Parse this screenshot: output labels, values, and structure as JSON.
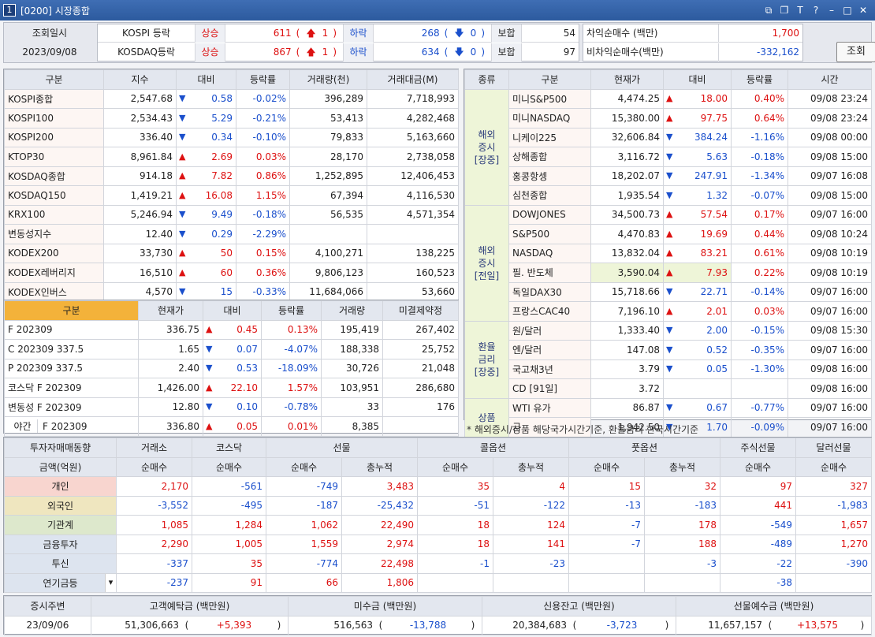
{
  "window": {
    "num": "1",
    "title": "[0200] 시장종합"
  },
  "topbar": {
    "date_label": "조회일시",
    "date_value": "2023/09/08",
    "rows": [
      {
        "market": "KOSPI 등락",
        "up_label": "상승",
        "up": "611",
        "up_limit": "1",
        "down_label": "하락",
        "down": "268",
        "down_limit": "0",
        "flat_label": "보합",
        "flat": "54"
      },
      {
        "market": "KOSDAQ등락",
        "up_label": "상승",
        "up": "867",
        "up_limit": "1",
        "down_label": "하락",
        "down": "634",
        "down_limit": "0",
        "flat_label": "보합",
        "flat": "97"
      }
    ],
    "program": [
      {
        "label": "차익순매수 (백만)",
        "value": "1,700"
      },
      {
        "label": "비차익순매수(백만)",
        "value": "-332,162"
      }
    ],
    "query_button": "조회"
  },
  "index_table": {
    "headers": [
      "구분",
      "지수",
      "대비",
      "등락률",
      "거래량(천)",
      "거래대금(M)"
    ],
    "rows": [
      {
        "name": "KOSPI종합",
        "value": "2,547.68",
        "dir": "dn",
        "chg": "0.58",
        "rate": "-0.02%",
        "vol": "396,289",
        "amt": "7,718,993"
      },
      {
        "name": "KOSPI100",
        "value": "2,534.43",
        "dir": "dn",
        "chg": "5.29",
        "rate": "-0.21%",
        "vol": "53,413",
        "amt": "4,282,468"
      },
      {
        "name": "KOSPI200",
        "value": "336.40",
        "dir": "dn",
        "chg": "0.34",
        "rate": "-0.10%",
        "vol": "79,833",
        "amt": "5,163,660"
      },
      {
        "name": "KTOP30",
        "value": "8,961.84",
        "dir": "up",
        "chg": "2.69",
        "rate": "0.03%",
        "vol": "28,170",
        "amt": "2,738,058"
      },
      {
        "name": "KOSDAQ종합",
        "value": "914.18",
        "dir": "up",
        "chg": "7.82",
        "rate": "0.86%",
        "vol": "1,252,895",
        "amt": "12,406,453"
      },
      {
        "name": "KOSDAQ150",
        "value": "1,419.21",
        "dir": "up",
        "chg": "16.08",
        "rate": "1.15%",
        "vol": "67,394",
        "amt": "4,116,530"
      },
      {
        "name": "KRX100",
        "value": "5,246.94",
        "dir": "dn",
        "chg": "9.49",
        "rate": "-0.18%",
        "vol": "56,535",
        "amt": "4,571,354"
      },
      {
        "name": "변동성지수",
        "value": "12.40",
        "dir": "dn",
        "chg": "0.29",
        "rate": "-2.29%",
        "vol": "",
        "amt": ""
      },
      {
        "name": "KODEX200",
        "value": "33,730",
        "dir": "up",
        "chg": "50",
        "rate": "0.15%",
        "vol": "4,100,271",
        "amt": "138,225"
      },
      {
        "name": "KODEX레버리지",
        "value": "16,510",
        "dir": "up",
        "chg": "60",
        "rate": "0.36%",
        "vol": "9,806,123",
        "amt": "160,523"
      },
      {
        "name": "KODEX인버스",
        "value": "4,570",
        "dir": "dn",
        "chg": "15",
        "rate": "-0.33%",
        "vol": "11,684,066",
        "amt": "53,660"
      }
    ]
  },
  "futures_table": {
    "headers": [
      "구분",
      "현재가",
      "대비",
      "등락률",
      "거래량",
      "미결제약정"
    ],
    "rows": [
      {
        "name": "F 202309",
        "value": "336.75",
        "dir": "up",
        "chg": "0.45",
        "rate": "0.13%",
        "vol": "195,419",
        "oi": "267,402"
      },
      {
        "name": "C 202309 337.5",
        "value": "1.65",
        "dir": "dn",
        "chg": "0.07",
        "rate": "-4.07%",
        "vol": "188,338",
        "oi": "25,752"
      },
      {
        "name": "P 202309 337.5",
        "value": "2.40",
        "dir": "dn",
        "chg": "0.53",
        "rate": "-18.09%",
        "vol": "30,726",
        "oi": "21,048"
      },
      {
        "name": "코스닥 F 202309",
        "value": "1,426.00",
        "dir": "up",
        "chg": "22.10",
        "rate": "1.57%",
        "vol": "103,951",
        "oi": "286,680"
      },
      {
        "name": "변동성 F 202309",
        "value": "12.80",
        "dir": "dn",
        "chg": "0.10",
        "rate": "-0.78%",
        "vol": "33",
        "oi": "176"
      }
    ],
    "night": {
      "tag": "야간",
      "name": "F 202309",
      "value": "336.80",
      "dir": "up",
      "chg": "0.05",
      "rate": "0.01%",
      "vol": "8,385",
      "oi": ""
    }
  },
  "overseas_table": {
    "headers": [
      "종류",
      "구분",
      "현재가",
      "대비",
      "등락률",
      "시간"
    ],
    "groups": [
      {
        "label": "해외\n증시\n[장중]",
        "rows": [
          {
            "name": "미니S&P500",
            "value": "4,474.25",
            "dir": "up",
            "chg": "18.00",
            "rate": "0.40%",
            "time": "09/08 23:24"
          },
          {
            "name": "미니NASDAQ",
            "value": "15,380.00",
            "dir": "up",
            "chg": "97.75",
            "rate": "0.64%",
            "time": "09/08 23:24"
          },
          {
            "name": "니케이225",
            "value": "32,606.84",
            "dir": "dn",
            "chg": "384.24",
            "rate": "-1.16%",
            "time": "09/08 00:00"
          },
          {
            "name": "상해종합",
            "value": "3,116.72",
            "dir": "dn",
            "chg": "5.63",
            "rate": "-0.18%",
            "time": "09/08 15:00"
          },
          {
            "name": "홍콩항셍",
            "value": "18,202.07",
            "dir": "dn",
            "chg": "247.91",
            "rate": "-1.34%",
            "time": "09/07 16:08"
          },
          {
            "name": "심천종합",
            "value": "1,935.54",
            "dir": "dn",
            "chg": "1.32",
            "rate": "-0.07%",
            "time": "09/08 15:00"
          }
        ]
      },
      {
        "label": "해외\n증시\n[전일]",
        "rows": [
          {
            "name": "DOWJONES",
            "value": "34,500.73",
            "dir": "up",
            "chg": "57.54",
            "rate": "0.17%",
            "time": "09/07 16:00"
          },
          {
            "name": "S&P500",
            "value": "4,470.83",
            "dir": "up",
            "chg": "19.69",
            "rate": "0.44%",
            "time": "09/08 10:24"
          },
          {
            "name": "NASDAQ",
            "value": "13,832.04",
            "dir": "up",
            "chg": "83.21",
            "rate": "0.61%",
            "time": "09/08 10:19"
          },
          {
            "name": "필. 반도체",
            "value": "3,590.04",
            "dir": "up",
            "chg": "7.93",
            "rate": "0.22%",
            "time": "09/08 10:19"
          },
          {
            "name": "독일DAX30",
            "value": "15,718.66",
            "dir": "dn",
            "chg": "22.71",
            "rate": "-0.14%",
            "time": "09/07 16:00"
          },
          {
            "name": "프랑스CAC40",
            "value": "7,196.10",
            "dir": "up",
            "chg": "2.01",
            "rate": "0.03%",
            "time": "09/07 16:00"
          }
        ]
      },
      {
        "label": "환율\n금리\n[장중]",
        "rows": [
          {
            "name": "원/달러",
            "value": "1,333.40",
            "dir": "dn",
            "chg": "2.00",
            "rate": "-0.15%",
            "time": "09/08 15:30"
          },
          {
            "name": "엔/달러",
            "value": "147.08",
            "dir": "dn",
            "chg": "0.52",
            "rate": "-0.35%",
            "time": "09/07 16:00"
          },
          {
            "name": "국고채3년",
            "value": "3.79",
            "dir": "dn",
            "chg": "0.05",
            "rate": "-1.30%",
            "time": "09/08 16:00"
          },
          {
            "name": "CD [91일]",
            "value": "3.72",
            "dir": "",
            "chg": "",
            "rate": "",
            "time": "09/08 16:00"
          }
        ]
      },
      {
        "label": "상품",
        "rows": [
          {
            "name": "WTI 유가",
            "value": "86.87",
            "dir": "dn",
            "chg": "0.67",
            "rate": "-0.77%",
            "time": "09/07 16:00"
          },
          {
            "name": "금",
            "value": "1,942.50",
            "dir": "dn",
            "chg": "1.70",
            "rate": "-0.09%",
            "time": "09/07 16:00"
          }
        ]
      }
    ],
    "note": "* 해외증시/상품 해당국가시간기준, 환율금리 한국시간기준"
  },
  "investor_table": {
    "title": "투자자매매동향",
    "unit_label": "금액(억원)",
    "col_groups": [
      "거래소",
      "코스닥",
      "선물",
      "콜옵션",
      "풋옵션",
      "주식선물",
      "달러선물"
    ],
    "sub_headers": [
      "순매수",
      "순매수",
      "순매수",
      "총누적",
      "순매수",
      "총누적",
      "순매수",
      "총누적",
      "순매수",
      "순매수"
    ],
    "rows": [
      {
        "name": "개인",
        "bg": "#f8d5cf",
        "vals": [
          "2,170",
          "-561",
          "-749",
          "3,483",
          "35",
          "4",
          "15",
          "32",
          "97",
          "327"
        ]
      },
      {
        "name": "외국인",
        "bg": "#efe6bf",
        "vals": [
          "-3,552",
          "-495",
          "-187",
          "-25,432",
          "-51",
          "-122",
          "-13",
          "-183",
          "441",
          "-1,983"
        ]
      },
      {
        "name": "기관계",
        "bg": "#dde8cc",
        "vals": [
          "1,085",
          "1,284",
          "1,062",
          "22,490",
          "18",
          "124",
          "-7",
          "178",
          "-549",
          "1,657"
        ]
      },
      {
        "name": "금융투자",
        "bg": "#dde4ef",
        "vals": [
          "2,290",
          "1,005",
          "1,559",
          "2,974",
          "18",
          "141",
          "-7",
          "188",
          "-489",
          "1,270"
        ]
      },
      {
        "name": "투신",
        "bg": "#dde4ef",
        "vals": [
          "-337",
          "35",
          "-774",
          "22,498",
          "-1",
          "-23",
          "",
          "-3",
          "-22",
          "-390"
        ]
      },
      {
        "name": "연기금등",
        "bg": "#dde4ef",
        "vals": [
          "-237",
          "91",
          "66",
          "1,806",
          "",
          "",
          "",
          "",
          "-38",
          ""
        ]
      }
    ]
  },
  "footer": {
    "headers": [
      "증시주변",
      "고객예탁금 (백만원)",
      "미수금 (백만원)",
      "신용잔고 (백만원)",
      "선물예수금 (백만원)"
    ],
    "date": "23/09/06",
    "deposit": "51,306,663",
    "deposit_chg": "+5,393",
    "unpaid": "516,563",
    "unpaid_chg": "-13,788",
    "credit": "20,384,683",
    "credit_chg": "-3,723",
    "fut_deposit": "11,657,157",
    "fut_deposit_chg": "+13,575"
  }
}
